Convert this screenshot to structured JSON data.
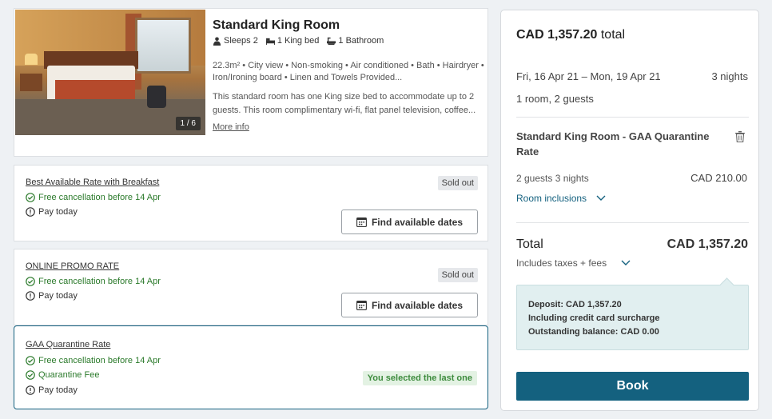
{
  "room": {
    "title": "Standard King Room",
    "sleeps": "Sleeps 2",
    "bed": "1 King bed",
    "bathroom": "1 Bathroom",
    "amenities": "22.3m² • City view • Non-smoking • Air conditioned • Bath • Hairdryer • Iron/Ironing board • Linen and Towels Provided...",
    "description": "This standard room has one King size bed to accommodate up to 2 guests. This room complimentary wi-fi, flat panel television, coffee...",
    "more_info": "More info",
    "photo_counter": "1 / 6"
  },
  "rates": [
    {
      "name": "Best Available Rate with Breakfast",
      "cancellation": "Free cancellation before 14 Apr",
      "payment": "Pay today",
      "badge": "Sold out",
      "button": "Find available dates"
    },
    {
      "name": "ONLINE PROMO RATE",
      "cancellation": "Free cancellation before 14 Apr",
      "payment": "Pay today",
      "badge": "Sold out",
      "button": "Find available dates"
    },
    {
      "name": "GAA Quarantine Rate",
      "cancellation": "Free cancellation before 14 Apr",
      "fee": "Quarantine Fee",
      "payment": "Pay today",
      "badge": "You selected the last one"
    }
  ],
  "summary": {
    "total_amount": "CAD 1,357.20",
    "total_word": "total",
    "dates": "Fri, 16 Apr 21 – Mon, 19 Apr 21",
    "nights": "3 nights",
    "rooms_guests": "1 room, 2 guests",
    "selected_room": "Standard King Room - GAA Quarantine Rate",
    "guests_nights": "2 guests 3 nights",
    "room_price": "CAD 210.00",
    "inclusions": "Room inclusions",
    "total_label": "Total",
    "total_value": "CAD 1,357.20",
    "taxes": "Includes taxes + fees",
    "deposit_line": "Deposit: CAD 1,357.20",
    "surcharge_line": "Including credit card surcharge",
    "balance_line": "Outstanding balance: CAD 0.00",
    "book": "Book"
  },
  "colors": {
    "primary": "#14617f",
    "success": "#2b7a2b",
    "deposit_bg": "#e1eff0"
  }
}
